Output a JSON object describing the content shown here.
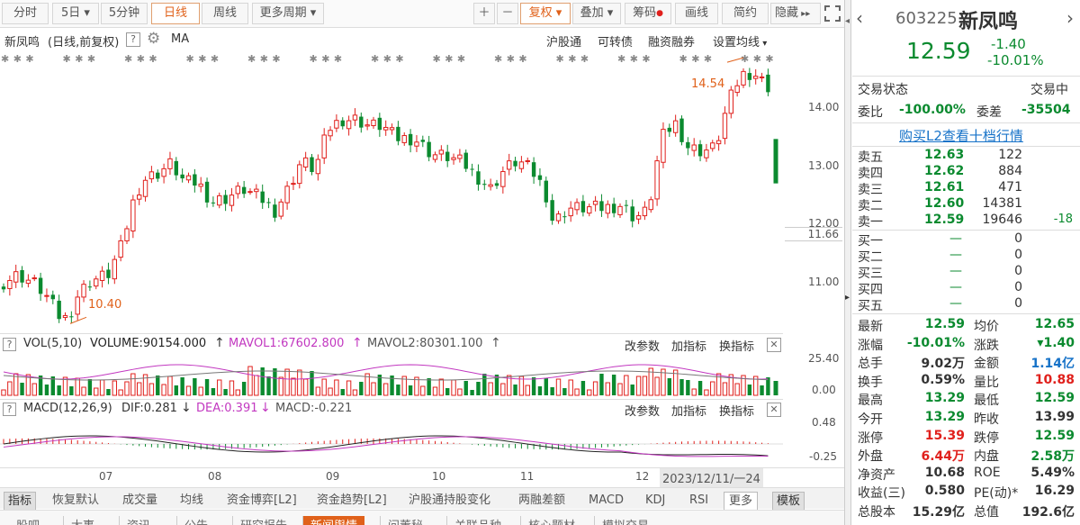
{
  "toolbar": {
    "periods": [
      "分时",
      "5日",
      "5分钟",
      "日线",
      "周线",
      "更多周期"
    ],
    "active": "日线",
    "fuquan": "复权",
    "diejia": "叠加",
    "chouma": "筹码",
    "huaxian": "画线",
    "jianyue": "简约",
    "yincang": "隐藏"
  },
  "chart": {
    "title": "新凤鸣",
    "subtitle": "(日线,前复权)",
    "ma": "MA",
    "links": [
      "沪股通",
      "可转债",
      "融资融券",
      "设置均线"
    ],
    "y_ticks": [
      "14.00",
      "13.00",
      "12.00",
      "11.00"
    ],
    "current_price": "11.66",
    "high_label": "14.54",
    "low_label": "10.40",
    "x_ticks": [
      "07",
      "08",
      "09",
      "10",
      "11",
      "12"
    ],
    "cursor_date": "2023/12/11/一",
    "cursor_tail": "24"
  },
  "chart_data": {
    "type": "candlestick",
    "y_range": [
      10.3,
      14.7
    ],
    "note_high": 14.54,
    "note_low": 10.4,
    "last_close": 12.59
  },
  "vol": {
    "title": "VOL(5,10)",
    "volume": "VOLUME:90154.000",
    "mavol1": "MAVOL1:67602.800",
    "mavol2": "MAVOL2:80301.100",
    "gaicanshu": "改参数",
    "jiazhibiao": "加指标",
    "huanzhibiao": "换指标",
    "y_ticks": [
      "25.40",
      "0.00"
    ]
  },
  "macd": {
    "title": "MACD(12,26,9)",
    "dif": "DIF:0.281",
    "dea": "DEA:0.391",
    "macd": "MACD:-0.221",
    "y_ticks": [
      "0.48",
      "-0.25"
    ]
  },
  "bottom_tabs": [
    "指标",
    "恢复默认",
    "成交量",
    "均线",
    "资金博弈[L2]",
    "资金趋势[L2]",
    "沪股通持股变化",
    "两融差额",
    "MACD",
    "KDJ",
    "RSI",
    "更多",
    "模板"
  ],
  "bottom_tabs2": [
    "股吧",
    "大事",
    "资讯",
    "公告",
    "研究报告",
    "新闻舆情",
    "问董秘",
    "关联品种",
    "核心题材",
    "模拟交易"
  ],
  "stock": {
    "code": "603225",
    "name": "新凤鸣",
    "price": "12.59",
    "change": "-1.40",
    "pct": "-10.01%"
  },
  "status": {
    "label": "交易状态",
    "value": "交易中"
  },
  "weibi": {
    "label": "委比",
    "value": "-100.00%",
    "label2": "委差",
    "value2": "-35504"
  },
  "l2link": "购买L2查看十档行情",
  "sells": [
    {
      "label": "卖五",
      "price": "12.63",
      "vol": "122",
      "chg": ""
    },
    {
      "label": "卖四",
      "price": "12.62",
      "vol": "884",
      "chg": ""
    },
    {
      "label": "卖三",
      "price": "12.61",
      "vol": "471",
      "chg": ""
    },
    {
      "label": "卖二",
      "price": "12.60",
      "vol": "14381",
      "chg": ""
    },
    {
      "label": "卖一",
      "price": "12.59",
      "vol": "19646",
      "chg": "-18"
    }
  ],
  "buys": [
    {
      "label": "买一",
      "price": "—",
      "vol": "0"
    },
    {
      "label": "买二",
      "price": "—",
      "vol": "0"
    },
    {
      "label": "买三",
      "price": "—",
      "vol": "0"
    },
    {
      "label": "买四",
      "price": "—",
      "vol": "0"
    },
    {
      "label": "买五",
      "price": "—",
      "vol": "0"
    }
  ],
  "stats": [
    {
      "l1": "最新",
      "v1": "12.59",
      "c1": "grn",
      "l2": "均价",
      "v2": "12.65",
      "c2": "grn"
    },
    {
      "l1": "涨幅",
      "v1": "-10.01%",
      "c1": "grn",
      "l2": "涨跌",
      "v2": "▾1.40",
      "c2": "grn"
    },
    {
      "l1": "总手",
      "v1": "9.02万",
      "c1": "",
      "l2": "金额",
      "v2": "1.14亿",
      "c2": "blu"
    },
    {
      "l1": "换手",
      "v1": "0.59%",
      "c1": "",
      "l2": "量比",
      "v2": "10.88",
      "c2": "red"
    },
    {
      "l1": "最高",
      "v1": "13.29",
      "c1": "grn",
      "l2": "最低",
      "v2": "12.59",
      "c2": "grn"
    },
    {
      "l1": "今开",
      "v1": "13.29",
      "c1": "grn",
      "l2": "昨收",
      "v2": "13.99",
      "c2": ""
    },
    {
      "l1": "涨停",
      "v1": "15.39",
      "c1": "red",
      "l2": "跌停",
      "v2": "12.59",
      "c2": "grn"
    },
    {
      "l1": "外盘",
      "v1": "6.44万",
      "c1": "red",
      "l2": "内盘",
      "v2": "2.58万",
      "c2": "grn"
    },
    {
      "l1": "净资产",
      "v1": "10.68",
      "c1": "",
      "l2": "ROE",
      "v2": "5.49%",
      "c2": ""
    },
    {
      "l1": "收益(三)",
      "v1": "0.580",
      "c1": "",
      "l2": "PE(动)*",
      "v2": "16.29",
      "c2": ""
    },
    {
      "l1": "总股本",
      "v1": "15.29亿",
      "c1": "",
      "l2": "总值",
      "v2": "192.6亿",
      "c2": ""
    }
  ],
  "colors": {
    "up": "#e0201c",
    "down": "#0b8a2f",
    "accent": "#e0611a",
    "link": "#1672c8"
  }
}
